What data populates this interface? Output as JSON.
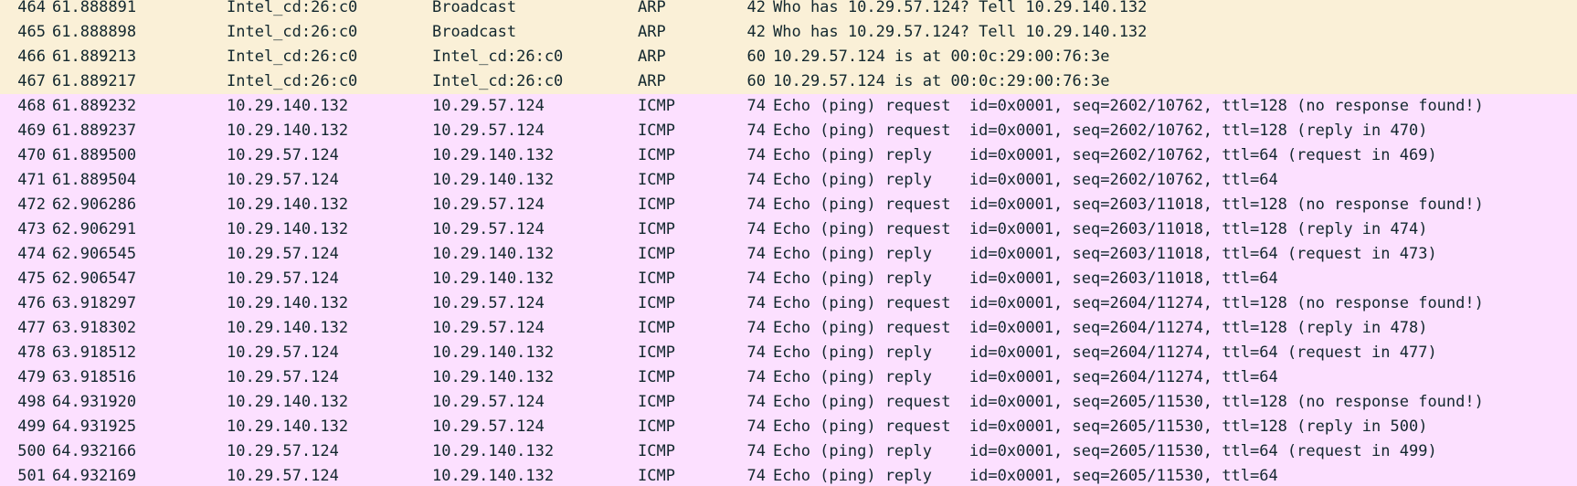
{
  "colors": {
    "arp_row_bg": "#faf0d7",
    "icmp_row_bg": "#fce0ff",
    "text": "#12272e"
  },
  "packets": [
    {
      "no": "464",
      "time": "61.888891",
      "source": "Intel_cd:26:c0",
      "destination": "Broadcast",
      "protocol": "ARP",
      "length": "42",
      "info": "Who has 10.29.57.124? Tell 10.29.140.132"
    },
    {
      "no": "465",
      "time": "61.888898",
      "source": "Intel_cd:26:c0",
      "destination": "Broadcast",
      "protocol": "ARP",
      "length": "42",
      "info": "Who has 10.29.57.124? Tell 10.29.140.132"
    },
    {
      "no": "466",
      "time": "61.889213",
      "source": "Intel_cd:26:c0",
      "destination": "Intel_cd:26:c0",
      "protocol": "ARP",
      "length": "60",
      "info": "10.29.57.124 is at 00:0c:29:00:76:3e"
    },
    {
      "no": "467",
      "time": "61.889217",
      "source": "Intel_cd:26:c0",
      "destination": "Intel_cd:26:c0",
      "protocol": "ARP",
      "length": "60",
      "info": "10.29.57.124 is at 00:0c:29:00:76:3e"
    },
    {
      "no": "468",
      "time": "61.889232",
      "source": "10.29.140.132",
      "destination": "10.29.57.124",
      "protocol": "ICMP",
      "length": "74",
      "info": "Echo (ping) request  id=0x0001, seq=2602/10762, ttl=128 (no response found!)"
    },
    {
      "no": "469",
      "time": "61.889237",
      "source": "10.29.140.132",
      "destination": "10.29.57.124",
      "protocol": "ICMP",
      "length": "74",
      "info": "Echo (ping) request  id=0x0001, seq=2602/10762, ttl=128 (reply in 470)"
    },
    {
      "no": "470",
      "time": "61.889500",
      "source": "10.29.57.124",
      "destination": "10.29.140.132",
      "protocol": "ICMP",
      "length": "74",
      "info": "Echo (ping) reply    id=0x0001, seq=2602/10762, ttl=64 (request in 469)"
    },
    {
      "no": "471",
      "time": "61.889504",
      "source": "10.29.57.124",
      "destination": "10.29.140.132",
      "protocol": "ICMP",
      "length": "74",
      "info": "Echo (ping) reply    id=0x0001, seq=2602/10762, ttl=64"
    },
    {
      "no": "472",
      "time": "62.906286",
      "source": "10.29.140.132",
      "destination": "10.29.57.124",
      "protocol": "ICMP",
      "length": "74",
      "info": "Echo (ping) request  id=0x0001, seq=2603/11018, ttl=128 (no response found!)"
    },
    {
      "no": "473",
      "time": "62.906291",
      "source": "10.29.140.132",
      "destination": "10.29.57.124",
      "protocol": "ICMP",
      "length": "74",
      "info": "Echo (ping) request  id=0x0001, seq=2603/11018, ttl=128 (reply in 474)"
    },
    {
      "no": "474",
      "time": "62.906545",
      "source": "10.29.57.124",
      "destination": "10.29.140.132",
      "protocol": "ICMP",
      "length": "74",
      "info": "Echo (ping) reply    id=0x0001, seq=2603/11018, ttl=64 (request in 473)"
    },
    {
      "no": "475",
      "time": "62.906547",
      "source": "10.29.57.124",
      "destination": "10.29.140.132",
      "protocol": "ICMP",
      "length": "74",
      "info": "Echo (ping) reply    id=0x0001, seq=2603/11018, ttl=64"
    },
    {
      "no": "476",
      "time": "63.918297",
      "source": "10.29.140.132",
      "destination": "10.29.57.124",
      "protocol": "ICMP",
      "length": "74",
      "info": "Echo (ping) request  id=0x0001, seq=2604/11274, ttl=128 (no response found!)"
    },
    {
      "no": "477",
      "time": "63.918302",
      "source": "10.29.140.132",
      "destination": "10.29.57.124",
      "protocol": "ICMP",
      "length": "74",
      "info": "Echo (ping) request  id=0x0001, seq=2604/11274, ttl=128 (reply in 478)"
    },
    {
      "no": "478",
      "time": "63.918512",
      "source": "10.29.57.124",
      "destination": "10.29.140.132",
      "protocol": "ICMP",
      "length": "74",
      "info": "Echo (ping) reply    id=0x0001, seq=2604/11274, ttl=64 (request in 477)"
    },
    {
      "no": "479",
      "time": "63.918516",
      "source": "10.29.57.124",
      "destination": "10.29.140.132",
      "protocol": "ICMP",
      "length": "74",
      "info": "Echo (ping) reply    id=0x0001, seq=2604/11274, ttl=64"
    },
    {
      "no": "498",
      "time": "64.931920",
      "source": "10.29.140.132",
      "destination": "10.29.57.124",
      "protocol": "ICMP",
      "length": "74",
      "info": "Echo (ping) request  id=0x0001, seq=2605/11530, ttl=128 (no response found!)"
    },
    {
      "no": "499",
      "time": "64.931925",
      "source": "10.29.140.132",
      "destination": "10.29.57.124",
      "protocol": "ICMP",
      "length": "74",
      "info": "Echo (ping) request  id=0x0001, seq=2605/11530, ttl=128 (reply in 500)"
    },
    {
      "no": "500",
      "time": "64.932166",
      "source": "10.29.57.124",
      "destination": "10.29.140.132",
      "protocol": "ICMP",
      "length": "74",
      "info": "Echo (ping) reply    id=0x0001, seq=2605/11530, ttl=64 (request in 499)"
    },
    {
      "no": "501",
      "time": "64.932169",
      "source": "10.29.57.124",
      "destination": "10.29.140.132",
      "protocol": "ICMP",
      "length": "74",
      "info": "Echo (ping) reply    id=0x0001, seq=2605/11530, ttl=64"
    }
  ]
}
